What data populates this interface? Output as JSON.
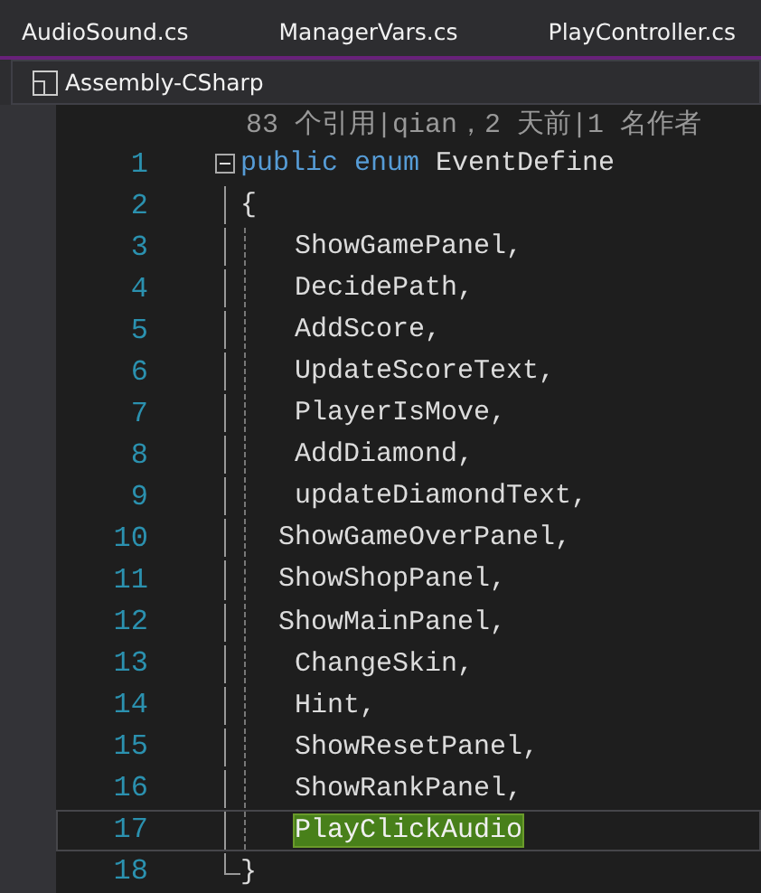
{
  "tabs": [
    {
      "label": "AudioSound.cs"
    },
    {
      "label": "ManagerVars.cs"
    },
    {
      "label": "PlayController.cs"
    }
  ],
  "project": {
    "label": "Assembly-CSharp"
  },
  "codelens": "83 个引用|qian，2 天前|1 名作者",
  "lines": [
    {
      "number": "1",
      "kind": "declaration",
      "selected": false,
      "tokens": [
        {
          "text": "public",
          "kind": "keyword"
        },
        {
          "text": "enum",
          "kind": "keyword"
        },
        {
          "text": "EventDefine",
          "kind": "name"
        }
      ]
    },
    {
      "number": "2",
      "kind": "open-brace",
      "selected": false,
      "text": "{"
    },
    {
      "number": "3",
      "kind": "member",
      "selected": false,
      "text": "   ShowGamePanel,"
    },
    {
      "number": "4",
      "kind": "member",
      "selected": false,
      "text": "   DecidePath,"
    },
    {
      "number": "5",
      "kind": "member",
      "selected": false,
      "text": "   AddScore,"
    },
    {
      "number": "6",
      "kind": "member",
      "selected": false,
      "text": "   UpdateScoreText,"
    },
    {
      "number": "7",
      "kind": "member",
      "selected": false,
      "text": "   PlayerIsMove,"
    },
    {
      "number": "8",
      "kind": "member",
      "selected": false,
      "text": "   AddDiamond,"
    },
    {
      "number": "9",
      "kind": "member",
      "selected": false,
      "text": "   updateDiamondText,"
    },
    {
      "number": "10",
      "kind": "member",
      "selected": false,
      "text": "  ShowGameOverPanel,"
    },
    {
      "number": "11",
      "kind": "member",
      "selected": false,
      "text": "  ShowShopPanel,"
    },
    {
      "number": "12",
      "kind": "member",
      "selected": false,
      "text": "  ShowMainPanel,"
    },
    {
      "number": "13",
      "kind": "member",
      "selected": false,
      "text": "   ChangeSkin,"
    },
    {
      "number": "14",
      "kind": "member",
      "selected": false,
      "text": "   Hint,"
    },
    {
      "number": "15",
      "kind": "member",
      "selected": false,
      "text": "   ShowResetPanel,"
    },
    {
      "number": "16",
      "kind": "member",
      "selected": false,
      "text": "   ShowRankPanel,"
    },
    {
      "number": "17",
      "kind": "member",
      "selected": true,
      "text": "   PlayClickAudio"
    },
    {
      "number": "18",
      "kind": "close-brace",
      "selected": false,
      "text": "}"
    }
  ]
}
